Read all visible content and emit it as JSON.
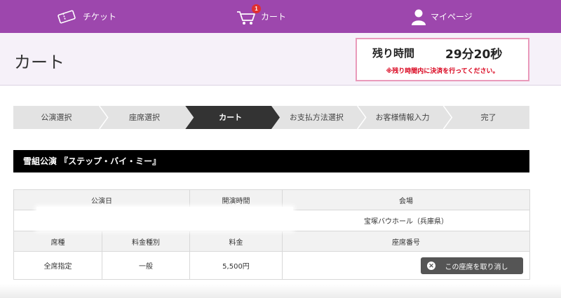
{
  "nav": {
    "ticket_label": "チケット",
    "cart_label": "カート",
    "cart_count": "1",
    "mypage_label": "マイページ"
  },
  "header": {
    "title": "カート",
    "timer_label": "残り時間",
    "timer_value": "29分20秒",
    "timer_note": "※残り時間内に決済を行ってください。"
  },
  "steps": [
    "公演選択",
    "座席選択",
    "カート",
    "お支払方法選択",
    "お客様情報入力",
    "完了"
  ],
  "active_step": 2,
  "performance": {
    "title": "雪組公演 『ステップ・バイ・ミー』"
  },
  "table": {
    "headers": {
      "date": "公演日",
      "time": "開演時間",
      "venue": "会場"
    },
    "info": {
      "date": "",
      "time": "",
      "venue": "宝塚バウホール（兵庫県）"
    },
    "seat_headers": {
      "seat_type": "席種",
      "price_type": "料金種別",
      "price": "料金",
      "seat_number": "座席番号"
    },
    "seat": {
      "seat_type": "全席指定",
      "price_type": "一般",
      "price": "5,500円"
    },
    "cancel_label": "この座席を取り消し"
  },
  "colors": {
    "brand": "#9d47ad",
    "accent": "#d9001b",
    "active_step": "#333333"
  },
  "icons": {
    "ticket": "ticket-icon",
    "cart": "cart-icon",
    "mypage": "user-icon",
    "cancel": "close-circle-icon"
  }
}
